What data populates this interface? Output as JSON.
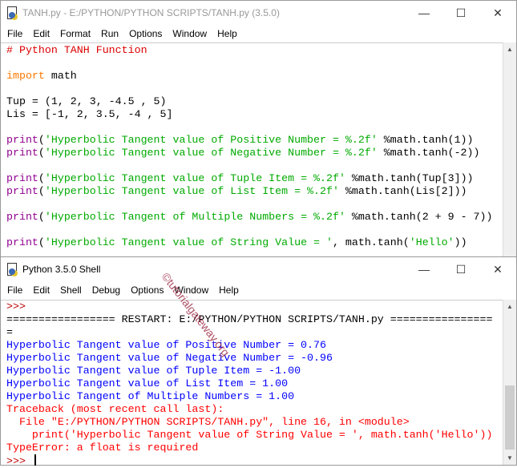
{
  "editor": {
    "title": "TANH.py - E:/PYTHON/PYTHON SCRIPTS/TANH.py (3.5.0)",
    "menu": [
      "File",
      "Edit",
      "Format",
      "Run",
      "Options",
      "Window",
      "Help"
    ],
    "lines": [
      [
        [
          "cmt",
          "# Python TANH Function"
        ]
      ],
      [],
      [
        [
          "kw",
          "import"
        ],
        [
          "df",
          " math"
        ]
      ],
      [],
      [
        [
          "df",
          "Tup = (1, 2, 3, -4.5 , 5)"
        ]
      ],
      [
        [
          "df",
          "Lis = [-1, 2, 3.5, -4 , 5]"
        ]
      ],
      [],
      [
        [
          "bi",
          "print"
        ],
        [
          "df",
          "("
        ],
        [
          "str",
          "'Hyperbolic Tangent value of Positive Number = %.2f'"
        ],
        [
          "df",
          " %math.tanh(1))"
        ]
      ],
      [
        [
          "bi",
          "print"
        ],
        [
          "df",
          "("
        ],
        [
          "str",
          "'Hyperbolic Tangent value of Negative Number = %.2f'"
        ],
        [
          "df",
          " %math.tanh(-2))"
        ]
      ],
      [],
      [
        [
          "bi",
          "print"
        ],
        [
          "df",
          "("
        ],
        [
          "str",
          "'Hyperbolic Tangent value of Tuple Item = %.2f'"
        ],
        [
          "df",
          " %math.tanh(Tup[3]))"
        ]
      ],
      [
        [
          "bi",
          "print"
        ],
        [
          "df",
          "("
        ],
        [
          "str",
          "'Hyperbolic Tangent value of List Item = %.2f'"
        ],
        [
          "df",
          " %math.tanh(Lis[2]))"
        ]
      ],
      [],
      [
        [
          "bi",
          "print"
        ],
        [
          "df",
          "("
        ],
        [
          "str",
          "'Hyperbolic Tangent of Multiple Numbers = %.2f'"
        ],
        [
          "df",
          " %math.tanh(2 + 9 - 7))"
        ]
      ],
      [],
      [
        [
          "bi",
          "print"
        ],
        [
          "df",
          "("
        ],
        [
          "str",
          "'Hyperbolic Tangent value of String Value = '"
        ],
        [
          "df",
          ", math.tanh("
        ],
        [
          "str",
          "'Hello'"
        ],
        [
          "df",
          "))"
        ]
      ]
    ]
  },
  "shell": {
    "title": "Python 3.5.0 Shell",
    "menu": [
      "File",
      "Edit",
      "Shell",
      "Debug",
      "Options",
      "Window",
      "Help"
    ],
    "lines": [
      [
        [
          "pr",
          ">>> "
        ]
      ],
      [
        [
          "sep",
          "================= RESTART: E:/PYTHON/PYTHON SCRIPTS/TANH.py ================"
        ]
      ],
      [
        [
          "sep",
          "="
        ]
      ],
      [
        [
          "out",
          "Hyperbolic Tangent value of Positive Number = 0.76"
        ]
      ],
      [
        [
          "out",
          "Hyperbolic Tangent value of Negative Number = -0.96"
        ]
      ],
      [
        [
          "out",
          "Hyperbolic Tangent value of Tuple Item = -1.00"
        ]
      ],
      [
        [
          "out",
          "Hyperbolic Tangent value of List Item = 1.00"
        ]
      ],
      [
        [
          "out",
          "Hyperbolic Tangent of Multiple Numbers = 1.00"
        ]
      ],
      [
        [
          "err",
          "Traceback (most recent call last):"
        ]
      ],
      [
        [
          "err",
          "  File \"E:/PYTHON/PYTHON SCRIPTS/TANH.py\", line 16, in <module>"
        ]
      ],
      [
        [
          "err",
          "    print('Hyperbolic Tangent value of String Value = ', math.tanh('Hello'))"
        ]
      ],
      [
        [
          "err",
          "TypeError: a float is required"
        ]
      ],
      [
        [
          "pr",
          ">>> "
        ]
      ]
    ]
  },
  "watermark": "©tutorialgateway.org",
  "controls": {
    "min": "—",
    "max": "☐",
    "close": "✕"
  }
}
